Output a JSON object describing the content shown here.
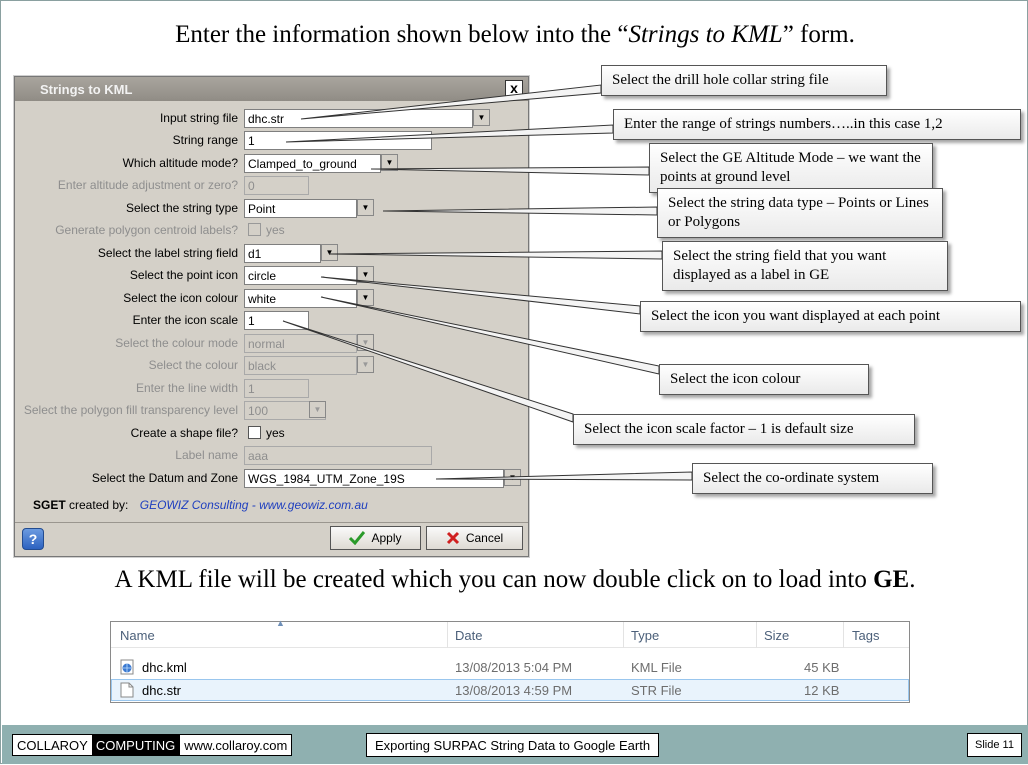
{
  "heading": {
    "prefix": "Enter the information shown below into the “",
    "form_name": "Strings to KML",
    "suffix": "” form."
  },
  "dialog": {
    "title": "Strings to KML",
    "close_label": "x",
    "fields": {
      "input_string_file": {
        "label": "Input string file",
        "value": "dhc.str"
      },
      "string_range": {
        "label": "String range",
        "value": "1"
      },
      "altitude_mode": {
        "label": "Which altitude mode?",
        "value": "Clamped_to_ground"
      },
      "altitude_adjustment": {
        "label": "Enter altitude adjustment or zero?",
        "value": "0"
      },
      "string_type": {
        "label": "Select the string type",
        "value": "Point"
      },
      "polygon_centroid": {
        "label": "Generate polygon centroid labels?",
        "option": "yes"
      },
      "label_string_field": {
        "label": "Select the label string field",
        "value": "d1"
      },
      "point_icon": {
        "label": "Select the point icon",
        "value": "circle"
      },
      "icon_colour": {
        "label": "Select the icon colour",
        "value": "white"
      },
      "icon_scale": {
        "label": "Enter the icon scale",
        "value": "1"
      },
      "colour_mode": {
        "label": "Select the colour mode",
        "value": "normal"
      },
      "colour": {
        "label": "Select the colour",
        "value": "black"
      },
      "line_width": {
        "label": "Enter the line width",
        "value": "1"
      },
      "fill_transparency": {
        "label": "Select the polygon fill transparency level",
        "value": "100"
      },
      "shape_file": {
        "label": "Create a shape file?",
        "option": "yes"
      },
      "label_name": {
        "label": "Label name",
        "value": "aaa"
      },
      "datum_zone": {
        "label": "Select the Datum and Zone",
        "value": "WGS_1984_UTM_Zone_19S"
      }
    },
    "credit": {
      "prefix": "SGET",
      "text": "created by:",
      "link": "GEOWIZ Consulting - www.geowiz.com.au"
    },
    "buttons": {
      "help": "?",
      "apply": "Apply",
      "cancel": "Cancel"
    }
  },
  "callouts": {
    "collar_file": "Select the drill hole collar string file",
    "range": "Enter the range of strings numbers…..in this case 1,2",
    "altitude": "Select the GE Altitude Mode – we want the points at ground level",
    "data_type": "Select the string data type – Points or Lines or Polygons",
    "label_field": "Select the string field that you want displayed as a label in GE",
    "icon": "Select the icon  you want displayed at each point",
    "icon_colour": "Select the icon colour",
    "icon_scale": "Select the icon scale factor – 1 is default size",
    "coord": "Select the co-ordinate system"
  },
  "bottom_text": {
    "prefix": "A KML file will be created which you can now double click on to load into ",
    "bold": "GE",
    "suffix": "."
  },
  "file_list": {
    "columns": [
      "Name",
      "Date",
      "Type",
      "Size",
      "Tags"
    ],
    "rows": [
      {
        "name": "dhc.kml",
        "date": "13/08/2013 5:04 PM",
        "type": "KML File",
        "size": "45 KB"
      },
      {
        "name": "dhc.str",
        "date": "13/08/2013 4:59 PM",
        "type": "STR File",
        "size": "12 KB"
      }
    ]
  },
  "footer": {
    "brand1": "COLLAROY",
    "brand2": "COMPUTING",
    "url": "www.collaroy.com",
    "title": "Exporting SURPAC String Data to Google Earth",
    "slide": "Slide 11"
  },
  "colors": {
    "footer_bg": "#8fb0b0",
    "dialog_bg": "#d4d0c8",
    "link": "#1f3fbf"
  }
}
